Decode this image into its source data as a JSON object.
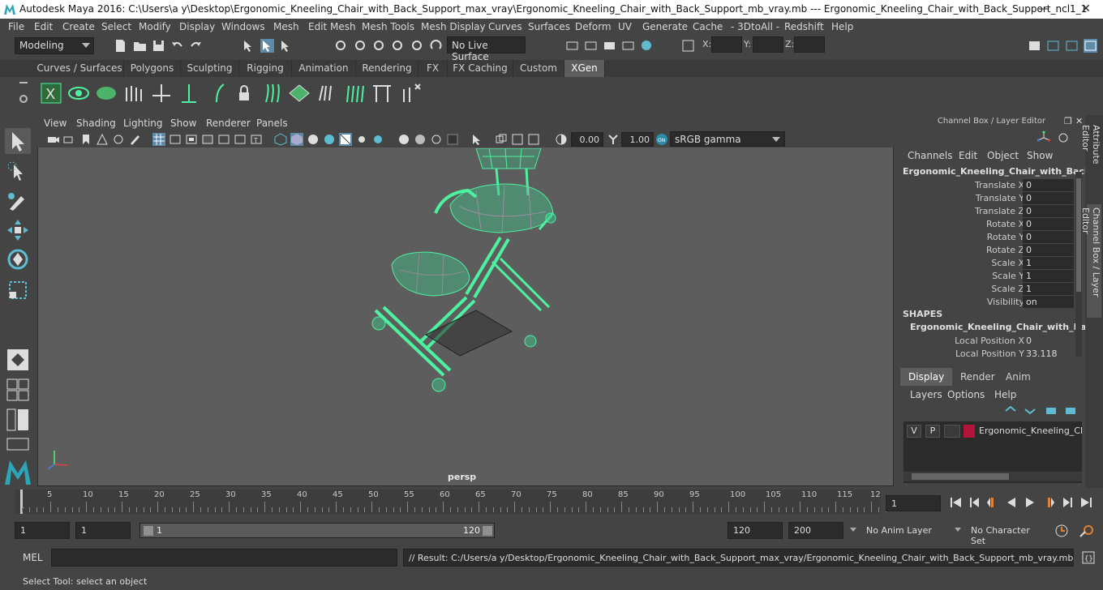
{
  "window": {
    "title": "Autodesk Maya 2016: C:\\Users\\a y\\Desktop\\Ergonomic_Kneeling_Chair_with_Back_Support_max_vray\\Ergonomic_Kneeling_Chair_with_Back_Support_mb_vray.mb   ---   Ergonomic_Kneeling_Chair_with_Back_Support_ncl1_1",
    "minimize": "—",
    "maximize": "❐",
    "close": "✕"
  },
  "menu": [
    "File",
    "Edit",
    "Create",
    "Select",
    "Modify",
    "Display",
    "Windows",
    "Mesh",
    "Edit Mesh",
    "Mesh Tools",
    "Mesh Display",
    "Curves",
    "Surfaces",
    "Deform",
    "UV",
    "Generate",
    "Cache",
    "- 3DtoAll -",
    "Redshift",
    "Help"
  ],
  "statusline": {
    "mode": "Modeling",
    "live_surface": "No Live Surface",
    "x_label": "X:",
    "y_label": "Y:",
    "z_label": "Z:"
  },
  "shelf_tabs": [
    "Curves / Surfaces",
    "Polygons",
    "Sculpting",
    "Rigging",
    "Animation",
    "Rendering",
    "FX",
    "FX Caching",
    "Custom",
    "XGen"
  ],
  "shelf_active": "XGen",
  "viewport": {
    "menu": [
      "View",
      "Shading",
      "Lighting",
      "Show",
      "Renderer",
      "Panels"
    ],
    "exposure": "0.00",
    "gamma_value": "1.00",
    "color_space": "sRGB gamma",
    "camera": "persp"
  },
  "channel_box": {
    "title": "Channel Box / Layer Editor",
    "menu": [
      "Channels",
      "Edit",
      "Object",
      "Show"
    ],
    "object": "Ergonomic_Kneeling_Chair_with_Back...",
    "attributes": [
      {
        "label": "Translate X",
        "value": "0"
      },
      {
        "label": "Translate Y",
        "value": "0"
      },
      {
        "label": "Translate Z",
        "value": "0"
      },
      {
        "label": "Rotate X",
        "value": "0"
      },
      {
        "label": "Rotate Y",
        "value": "0"
      },
      {
        "label": "Rotate Z",
        "value": "0"
      },
      {
        "label": "Scale X",
        "value": "1"
      },
      {
        "label": "Scale Y",
        "value": "1"
      },
      {
        "label": "Scale Z",
        "value": "1"
      },
      {
        "label": "Visibility",
        "value": "on"
      }
    ],
    "shapes_header": "SHAPES",
    "shape_name": "Ergonomic_Kneeling_Chair_with_Ba...",
    "shape_attributes": [
      {
        "label": "Local Position X",
        "value": "0"
      },
      {
        "label": "Local Position Y",
        "value": "33.118"
      }
    ]
  },
  "side_tabs": [
    "Attribute Editor",
    "Channel Box / Layer Editor"
  ],
  "layer_editor": {
    "tabs": [
      "Display",
      "Render",
      "Anim"
    ],
    "menu": [
      "Layers",
      "Options",
      "Help"
    ],
    "layer": {
      "v": "V",
      "p": "P",
      "name": "Ergonomic_Kneeling_Ch",
      "color": "#b3153a"
    }
  },
  "timeline": {
    "ticks": [
      "1",
      "5",
      "10",
      "15",
      "20",
      "25",
      "30",
      "35",
      "40",
      "45",
      "50",
      "55",
      "60",
      "65",
      "70",
      "75",
      "80",
      "85",
      "90",
      "95",
      "100",
      "105",
      "110",
      "115",
      "12"
    ],
    "current_frame": "1"
  },
  "range": {
    "start": "1",
    "playback_start": "1",
    "bar_start": "1",
    "bar_end": "120",
    "playback_end": "120",
    "end": "200",
    "anim_layer": "No Anim Layer",
    "character_set": "No Character Set"
  },
  "command_line": {
    "label": "MEL",
    "result": "// Result: C:/Users/a y/Desktop/Ergonomic_Kneeling_Chair_with_Back_Support_max_vray/Ergonomic_Kneeling_Chair_with_Back_Support_mb_vray.mb"
  },
  "help_line": "Select Tool: select an object",
  "colors": {
    "accent": "#5dbcd2",
    "wireframe": "#4cf2a0",
    "viewport_bg": "#5d5d5d"
  }
}
